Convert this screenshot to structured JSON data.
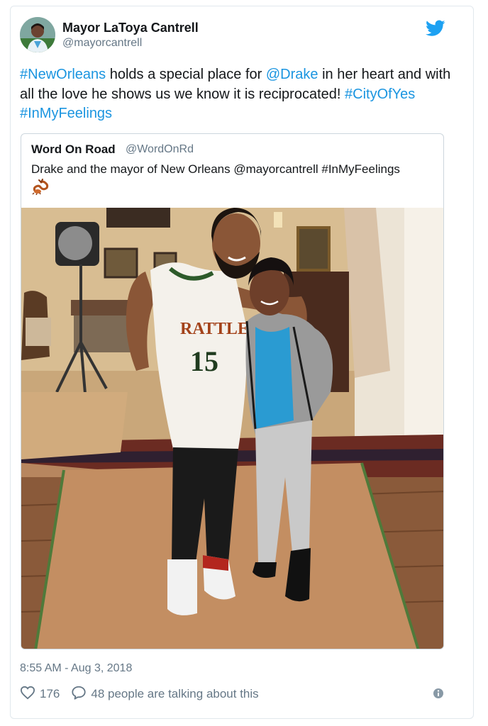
{
  "tweet": {
    "author_name": "Mayor LaToya Cantrell",
    "author_handle": "@mayorcantrell",
    "text_parts": {
      "p1": "#NewOrleans",
      "p2": " holds a special place for ",
      "p3": "@Drake",
      "p4": " in her heart and with all the love he shows us we know it is reciprocated! ",
      "p5": "#CityOfYes",
      "p6": " ",
      "p7": "#InMyFeelings"
    },
    "timestamp": "8:55 AM - Aug 3, 2018",
    "likes": "176",
    "talking": "48 people are talking about this",
    "brand_color": "#1da1f2",
    "link_color": "#1b95e0",
    "icons": [
      "twitter-bird-icon",
      "heart-icon",
      "speech-bubble-icon",
      "info-icon"
    ]
  },
  "quoted": {
    "author_name": "Word On Road",
    "author_handle": "@WordOnRd",
    "text": "Drake and the mayor of New Orleans @mayorcantrell #InMyFeelings",
    "emoji": "scorpion-emoji"
  }
}
